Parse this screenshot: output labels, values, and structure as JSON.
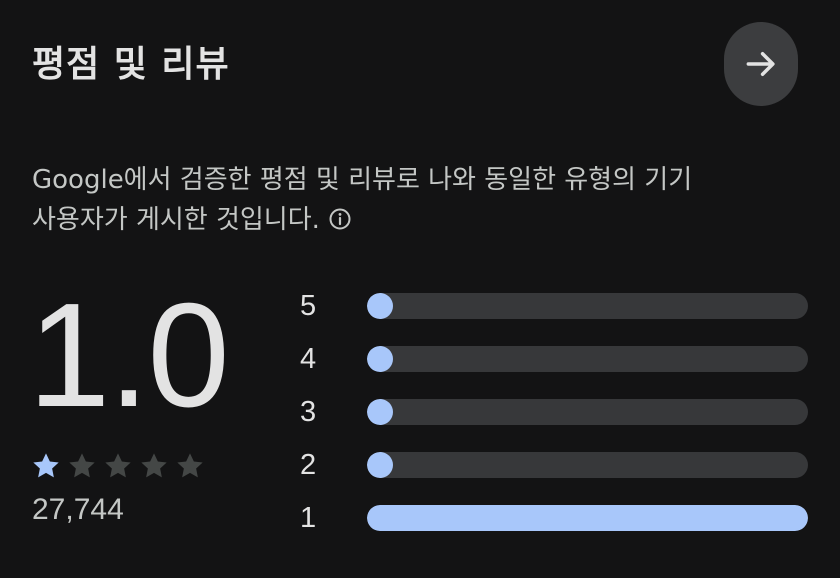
{
  "header": {
    "title": "평점 및 리뷰",
    "next_icon": "arrow-right-icon"
  },
  "description": {
    "line1": "Google에서 검증한 평점 및 리뷰로 나와 동일한 유형의 기기",
    "line2": "사용자가 게시한 것입니다.",
    "info_icon": "info-icon"
  },
  "summary": {
    "score": "1.0",
    "stars_filled": 1,
    "stars_total": 5,
    "review_count": "27,744"
  },
  "histogram": [
    {
      "label": "5",
      "fraction": 0.0
    },
    {
      "label": "4",
      "fraction": 0.0
    },
    {
      "label": "3",
      "fraction": 0.0
    },
    {
      "label": "2",
      "fraction": 0.0
    },
    {
      "label": "1",
      "fraction": 1.0
    }
  ],
  "colors": {
    "background": "#131314",
    "accent": "#a8c7fa",
    "track": "#37383a",
    "star_empty": "#444746",
    "button_bg": "#3c3d3f"
  }
}
